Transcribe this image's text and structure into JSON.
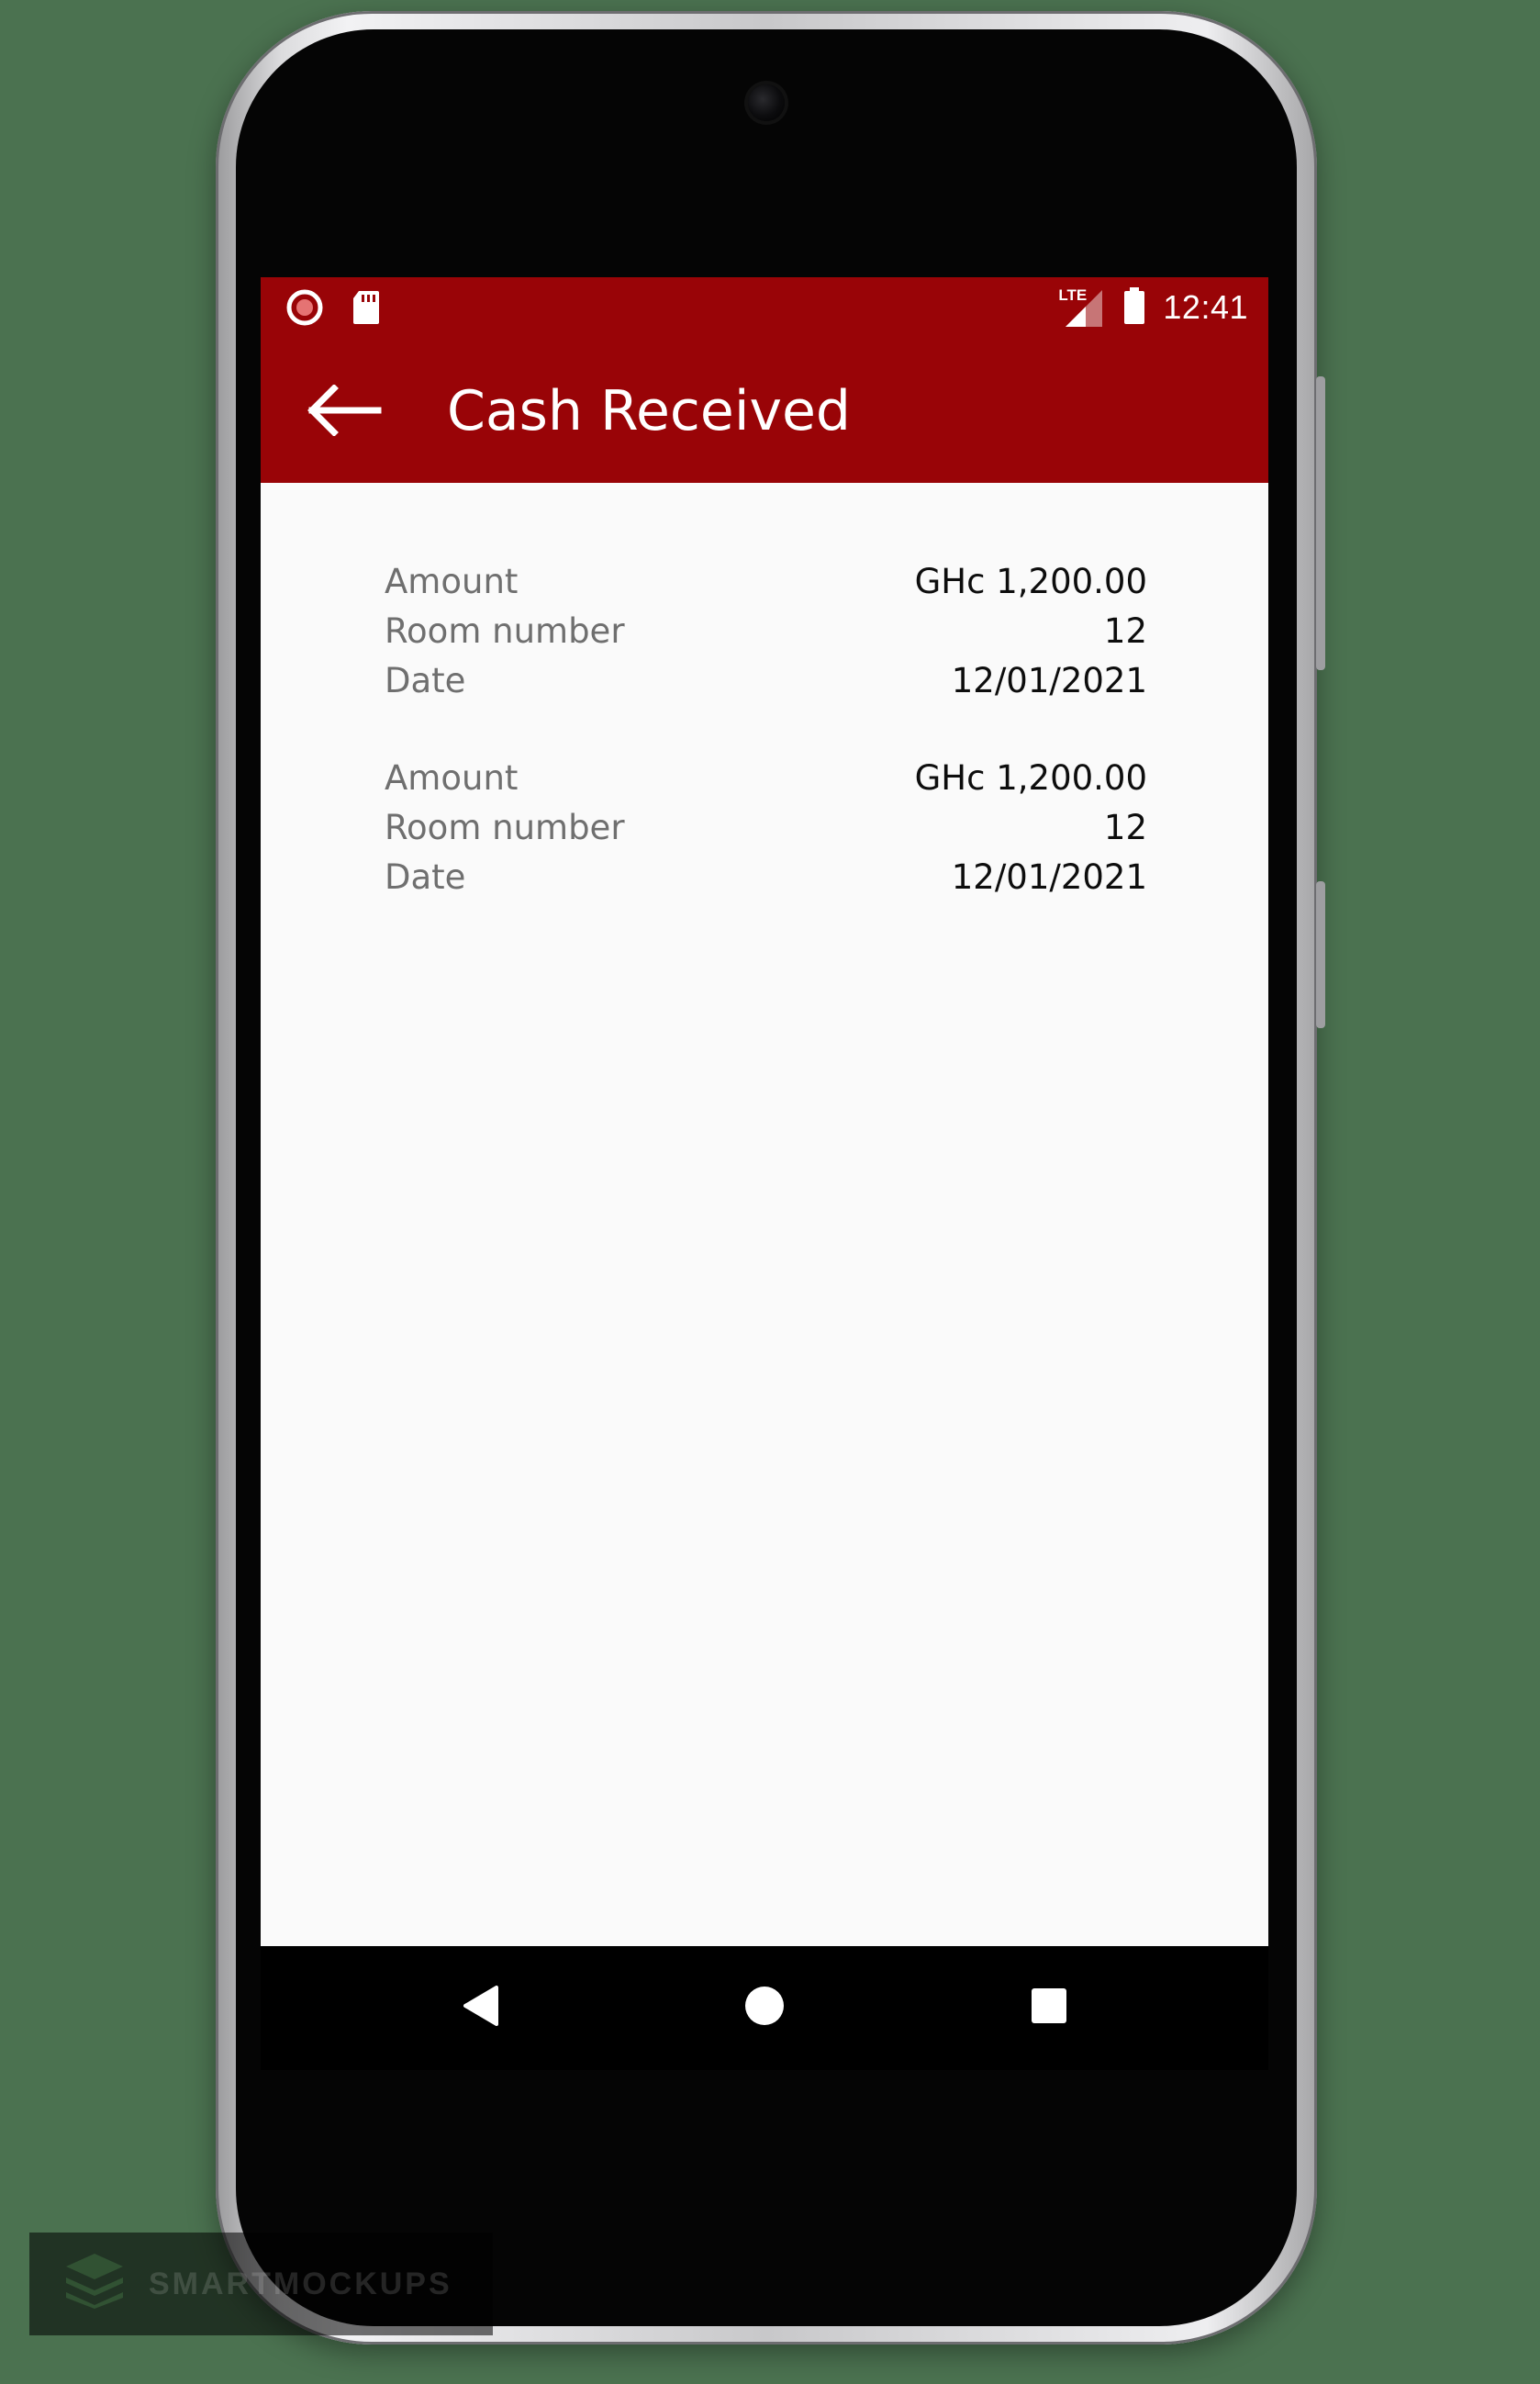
{
  "status_bar": {
    "time": "12:41",
    "network_label": "LTE",
    "icons": [
      "record-icon",
      "sd-card-icon",
      "lte-signal-icon",
      "battery-icon"
    ]
  },
  "app_bar": {
    "title": "Cash Received",
    "back_icon": "arrow-left-icon",
    "color": "#990407"
  },
  "records": [
    {
      "amount_label": "Amount",
      "amount": "GHc 1,200.00",
      "room_label": "Room number",
      "room": "12",
      "date_label": "Date",
      "date": "12/01/2021"
    },
    {
      "amount_label": "Amount",
      "amount": "GHc 1,200.00",
      "room_label": "Room number",
      "room": "12",
      "date_label": "Date",
      "date": "12/01/2021"
    }
  ],
  "nav_bar": {
    "icons": [
      "back-triangle-icon",
      "home-circle-icon",
      "recents-square-icon"
    ]
  },
  "watermark": {
    "text": "SMARTMOCKUPS"
  }
}
